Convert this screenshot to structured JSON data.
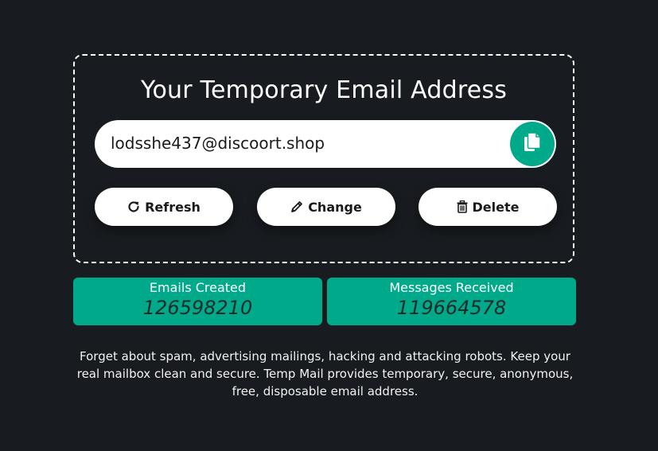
{
  "card": {
    "title": "Your Temporary Email Address",
    "email": "lodsshe437@discoort.shop",
    "copy_icon": "copy-icon"
  },
  "actions": {
    "refresh": {
      "label": "Refresh",
      "icon": "refresh-icon"
    },
    "change": {
      "label": "Change",
      "icon": "pencil-icon"
    },
    "delete": {
      "label": "Delete",
      "icon": "trash-icon"
    }
  },
  "stats": {
    "emails_created": {
      "label": "Emails Created",
      "value": "126598210"
    },
    "messages_received": {
      "label": "Messages Received",
      "value": "119664578"
    }
  },
  "description": "Forget about spam, advertising mailings, hacking and attacking robots. Keep your real mailbox clean and secure. Temp Mail provides temporary, secure, anonymous, free, disposable email address.",
  "colors": {
    "background": "#181b1f",
    "accent": "#00a98a",
    "button_bg": "#ffffff"
  }
}
